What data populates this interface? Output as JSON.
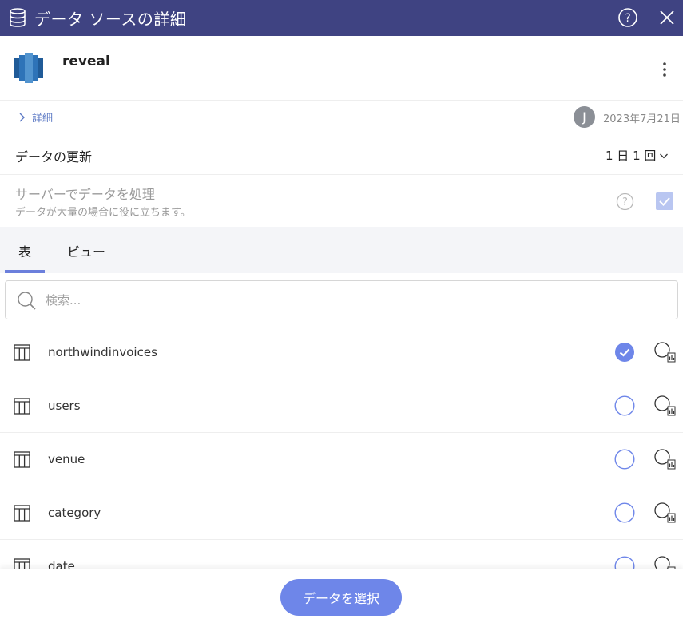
{
  "header": {
    "title": "データ ソースの詳細",
    "icons": {
      "database": "database-icon",
      "help": "help-icon",
      "close": "close-icon"
    },
    "background": "#3f4382"
  },
  "source": {
    "name": "reveal",
    "subtitle": "",
    "logo": "amazon-redshift-logo",
    "menu_icon": "kebab-menu-icon"
  },
  "details": {
    "link_label": "詳細",
    "avatar_initial": "J",
    "date": "2023年7月21日"
  },
  "refresh": {
    "label": "データの更新",
    "value": "1 日 1 回"
  },
  "server_processing": {
    "title": "サーバーでデータを処理",
    "subtitle": "データが大量の場合に役に立ちます。",
    "checked": true
  },
  "tabs": [
    {
      "label": "表",
      "active": true
    },
    {
      "label": "ビュー",
      "active": false
    }
  ],
  "search": {
    "placeholder": "検索...",
    "value": ""
  },
  "tables": [
    {
      "name": "northwindinvoices",
      "selected": true
    },
    {
      "name": "users",
      "selected": false
    },
    {
      "name": "venue",
      "selected": false
    },
    {
      "name": "category",
      "selected": false
    },
    {
      "name": "date",
      "selected": false
    }
  ],
  "footer": {
    "select_button": "データを選択"
  },
  "colors": {
    "accent": "#6e86e9",
    "header": "#3f4382",
    "link": "#5b78c4"
  }
}
